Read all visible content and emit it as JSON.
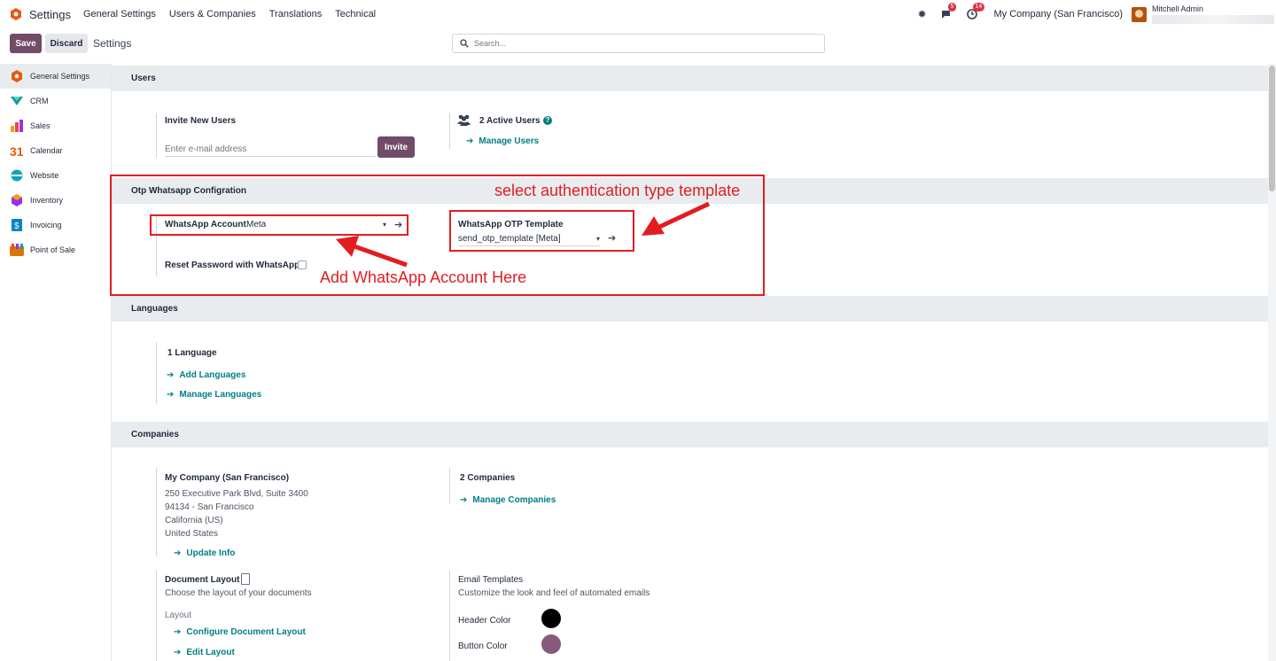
{
  "topbar": {
    "app_name": "Settings",
    "menu": [
      "General Settings",
      "Users & Companies",
      "Translations",
      "Technical"
    ],
    "messages_badge": "5",
    "activity_badge": "14",
    "company": "My Company (San Francisco)",
    "user_name": "Mitchell Admin"
  },
  "control": {
    "save_label": "Save",
    "discard_label": "Discard",
    "breadcrumb": "Settings",
    "search_placeholder": "Search..."
  },
  "sidebar": {
    "items": [
      {
        "label": "General Settings",
        "color": "#e8590c"
      },
      {
        "label": "CRM",
        "color": "#0f9d9a"
      },
      {
        "label": "Sales",
        "color": "#f59e0b"
      },
      {
        "label": "Calendar",
        "color": "#e11d21"
      },
      {
        "label": "Website",
        "color": "#0ea5b7"
      },
      {
        "label": "Inventory",
        "color": "#9333ea"
      },
      {
        "label": "Invoicing",
        "color": "#0284c7"
      },
      {
        "label": "Point of Sale",
        "color": "#d97706"
      }
    ]
  },
  "users": {
    "title": "Users",
    "invite_label": "Invite New Users",
    "email_placeholder": "Enter e-mail address",
    "invite_button": "Invite",
    "active_users": "2 Active Users",
    "manage_users": "Manage Users"
  },
  "otp": {
    "title": "Otp Whatsapp Configration",
    "account_label": "WhatsApp Account",
    "account_value": "Meta",
    "template_label": "WhatsApp OTP Template",
    "template_value": "send_otp_template [Meta]",
    "reset_label": "Reset Password with WhatsApp"
  },
  "annotations": {
    "template_note": "select authentication type template",
    "account_note": "Add WhatsApp Account Here"
  },
  "languages": {
    "title": "Languages",
    "count": "1 Language",
    "add": "Add Languages",
    "manage": "Manage Languages"
  },
  "companies": {
    "title": "Companies",
    "company_name": "My Company (San Francisco)",
    "address1": "250 Executive Park Blvd, Suite 3400",
    "address2": "94134 - San Francisco",
    "address3": "California (US)",
    "address4": "United States",
    "update_info": "Update Info",
    "count": "2 Companies",
    "manage": "Manage Companies",
    "doc_layout_label": "Document Layout",
    "doc_layout_desc": "Choose the layout of your documents",
    "layout_label": "Layout",
    "configure_layout": "Configure Document Layout",
    "edit_layout": "Edit Layout",
    "email_templates_label": "Email Templates",
    "email_templates_desc": "Customize the look and feel of automated emails",
    "header_color_label": "Header Color",
    "header_color": "#000000",
    "button_color_label": "Button Color",
    "button_color": "#875a7b"
  }
}
